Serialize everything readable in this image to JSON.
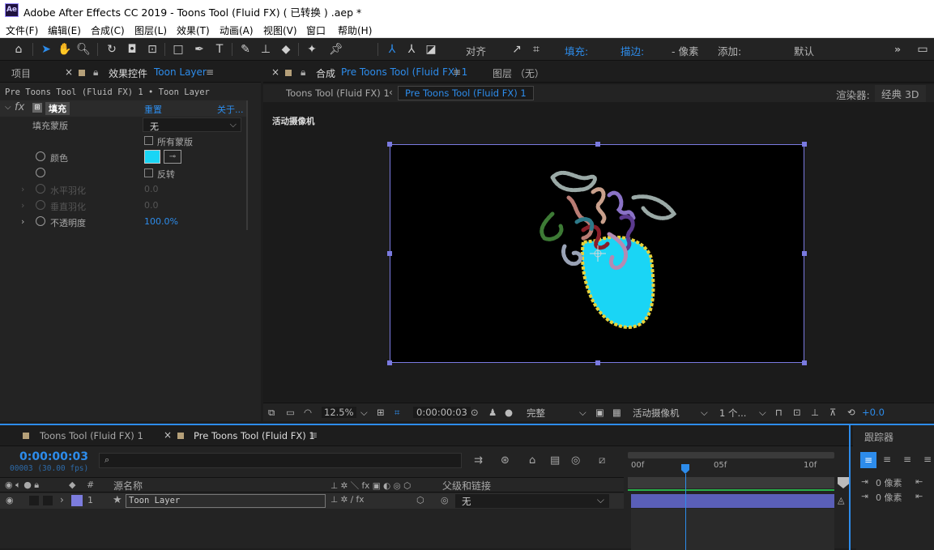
{
  "window": {
    "title": "Adobe After Effects CC 2019 - Toons Tool (Fluid FX) ( 已转换 ) .aep *",
    "logo": "Ae"
  },
  "menu": [
    "文件(F)",
    "编辑(E)",
    "合成(C)",
    "图层(L)",
    "效果(T)",
    "动画(A)",
    "视图(V)",
    "窗口",
    "帮助(H)"
  ],
  "toolbar": {
    "align_label": "对齐",
    "fill_label": "填充:",
    "stroke_label": "描边:",
    "stroke_units": "- 像素",
    "add_label": "添加:",
    "workspace": "默认",
    "overflow": "»"
  },
  "left_panel": {
    "tab_project": "项目",
    "tab_effects": "效果控件",
    "tab_effects_layer": "Toon Layer",
    "layer_path": "Pre Toons Tool (Fluid FX) 1 • Toon Layer",
    "effect_name": "填充",
    "reset": "重置",
    "about": "关于...",
    "rows": {
      "mask_label": "填充蒙版",
      "mask_value": "无",
      "all_masks": "所有蒙版",
      "color_label": "颜色",
      "color_value": "#1ad5f5",
      "invert": "反转",
      "h_feather": "水平羽化",
      "h_feather_val": "0.0",
      "v_feather": "垂直羽化",
      "v_feather_val": "0.0",
      "opacity": "不透明度",
      "opacity_val": "100.0%"
    }
  },
  "comp_panel": {
    "tab_comp_prefix": "合成",
    "tab_comp": "Pre Toons Tool (Fluid FX) 1",
    "tab_layer": "图层 （无）",
    "crumb1": "Toons Tool (Fluid FX) 1",
    "crumb2": "Pre Toons Tool (Fluid FX) 1",
    "renderer_label": "渲染器:",
    "renderer_value": "经典 3D",
    "camera_label": "活动摄像机",
    "bottom": {
      "zoom": "12.5%",
      "timecode": "0:00:00:03",
      "quality": "完整",
      "camera": "活动摄像机",
      "views": "1 个...",
      "exposure": "+0.0"
    }
  },
  "timeline": {
    "tab1": "Toons Tool (Fluid FX) 1",
    "tab2": "Pre Toons Tool (Fluid FX) 1",
    "timecode": "0:00:00:03",
    "frames": "00003 (30.00 fps)",
    "search_placeholder": "",
    "col_num": "#",
    "col_source": "源名称",
    "col_parent": "父级和链接",
    "layer": {
      "num": "1",
      "name": "Toon Layer",
      "parent": "无",
      "label_color": "#7c7cde"
    },
    "ruler": [
      "00f",
      "05f",
      "10f"
    ],
    "tracker_tab": "跟踪器",
    "para_indent1": "0 像素",
    "para_indent2": "0 像素"
  }
}
